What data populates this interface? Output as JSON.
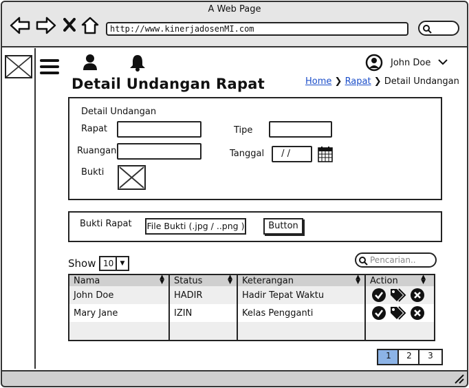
{
  "browser": {
    "title": "A Web Page",
    "url": "http://www.kinerjadosenMI.com"
  },
  "header": {
    "user_name": "John Doe"
  },
  "page": {
    "title": "Detail Undangan Rapat",
    "breadcrumb": {
      "home": "Home",
      "rapat": "Rapat",
      "current": "Detail Undangan"
    }
  },
  "form": {
    "section_title": "Detail Undangan",
    "rapat_label": "Rapat",
    "tipe_label": "Tipe",
    "ruangan_label": "Ruangan",
    "tanggal_label": "Tanggal",
    "tanggal_value": " / /",
    "bukti_label": "Bukti"
  },
  "upload": {
    "label": "Bukti Rapat",
    "file_text": "File Bukti (.jpg / ..png )",
    "button_label": "Button"
  },
  "table_controls": {
    "show_label": "Show",
    "show_value": "10",
    "search_placeholder": "Pencarian.."
  },
  "table": {
    "headers": [
      "Nama",
      "Status",
      "Keterangan",
      "Action"
    ],
    "rows": [
      {
        "nama": "John Doe",
        "status": "HADIR",
        "keterangan": "Hadir Tepat Waktu"
      },
      {
        "nama": "Mary Jane",
        "status": "IZIN",
        "keterangan": "Kelas Pengganti"
      }
    ]
  },
  "pagination": {
    "pages": [
      "1",
      "2",
      "3"
    ],
    "active": "1"
  },
  "colors": {
    "active_page": "#8cb3e6",
    "link": "#1b4ec9",
    "header_bg": "#cfcfcf"
  }
}
